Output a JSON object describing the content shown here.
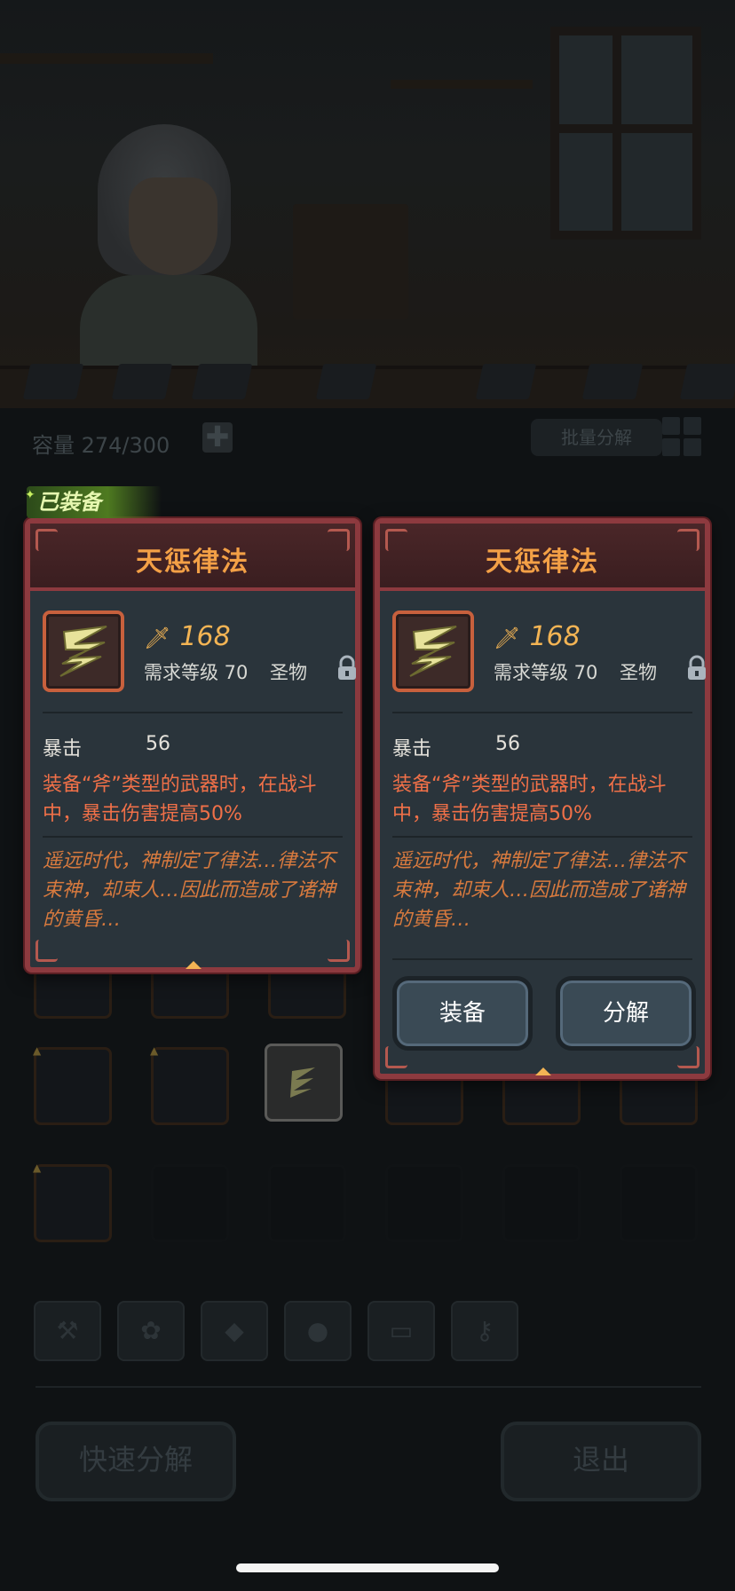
{
  "inventory": {
    "capacity_label": "容量 274/300",
    "plus_label": "✚",
    "bulk_decompose_label": "批量分解"
  },
  "categories": [
    "weapon-axe-icon",
    "paw-icon",
    "gem-icon",
    "rock-icon",
    "chest-icon",
    "key-icon"
  ],
  "bottom": {
    "quick_decompose_label": "快速分解",
    "exit_label": "退出"
  },
  "equipped_card": {
    "badge": "已装备",
    "title": "天惩律法",
    "power": "168",
    "required_level": "需求等级 70",
    "type": "圣物",
    "stat_name": "暴击",
    "stat_value": "56",
    "effect": "装备“斧”类型的武器时，在战斗中，暴击伤害提高50%",
    "lore": "遥远时代，神制定了律法…律法不束神，却束人…因此而造成了诸神的黄昏…"
  },
  "selected_card": {
    "title": "天惩律法",
    "power": "168",
    "required_level": "需求等级 70",
    "type": "圣物",
    "stat_name": "暴击",
    "stat_value": "56",
    "effect": "装备“斧”类型的武器时，在战斗中，暴击伤害提高50%",
    "lore": "遥远时代，神制定了律法…律法不束神，却束人…因此而造成了诸神的黄昏…",
    "equip_label": "装备",
    "decompose_label": "分解"
  },
  "colors": {
    "card_border": "#8d3a3f",
    "title": "#f3a046",
    "power": "#f3b454",
    "effect": "#f07048",
    "lore": "#d87a3e"
  }
}
